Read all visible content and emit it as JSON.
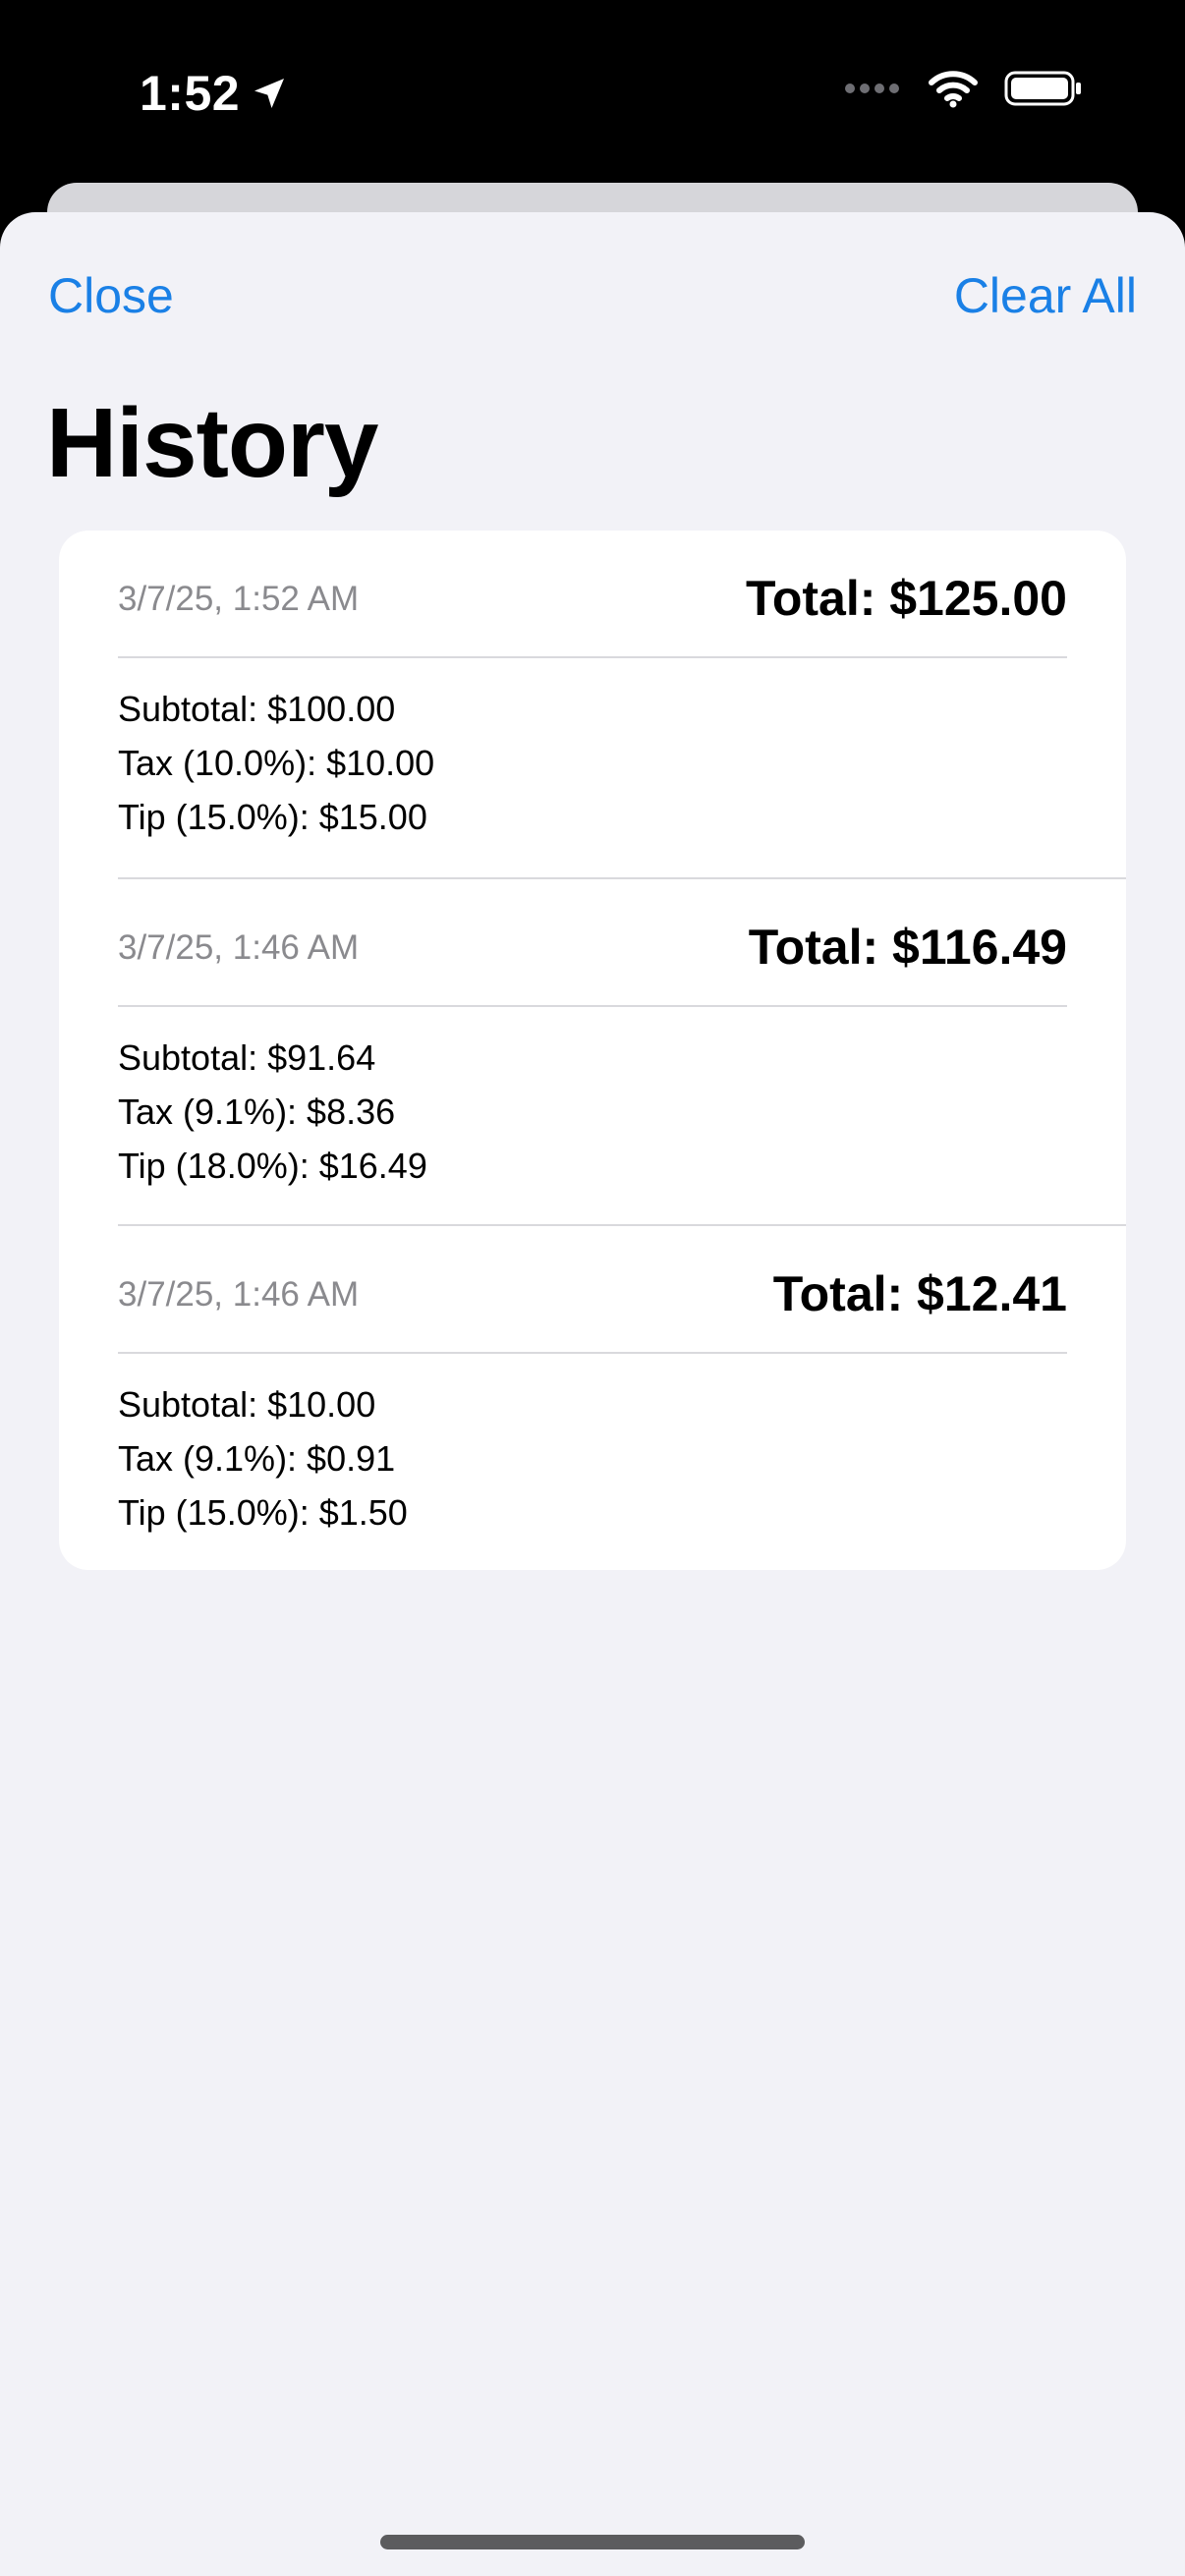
{
  "status_bar": {
    "time": "1:52",
    "icons": [
      "location-arrow-icon",
      "cellular-dots-icon",
      "wifi-icon",
      "battery-icon"
    ]
  },
  "nav": {
    "close_label": "Close",
    "clear_all_label": "Clear All"
  },
  "page": {
    "title": "History"
  },
  "entries": [
    {
      "date": "3/7/25, 1:52 AM",
      "total": "Total: $125.00",
      "subtotal": "Subtotal: $100.00",
      "tax": "Tax (10.0%): $10.00",
      "tip": "Tip (15.0%): $15.00"
    },
    {
      "date": "3/7/25, 1:46 AM",
      "total": "Total: $116.49",
      "subtotal": "Subtotal: $91.64",
      "tax": "Tax (9.1%): $8.36",
      "tip": "Tip (18.0%): $16.49"
    },
    {
      "date": "3/7/25, 1:46 AM",
      "total": "Total: $12.41",
      "subtotal": "Subtotal: $10.00",
      "tax": "Tax (9.1%): $0.91",
      "tip": "Tip (15.0%): $1.50"
    }
  ],
  "colors": {
    "accent": "#1a80e6",
    "background": "#f2f2f7",
    "card": "#ffffff",
    "secondary_text": "#8a8a8e"
  }
}
